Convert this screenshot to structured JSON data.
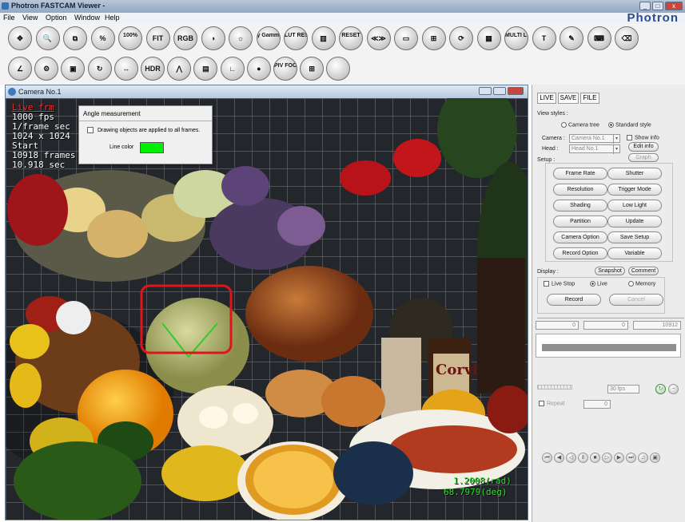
{
  "window": {
    "title": "Photron FASTCAM Viewer -",
    "brand": "Photron"
  },
  "menu": [
    "File",
    "View",
    "Option",
    "Window",
    "Help"
  ],
  "toolbar1": [
    {
      "icon": "move-icon",
      "label": "✥"
    },
    {
      "icon": "zoom-icon",
      "label": "🔍"
    },
    {
      "icon": "crop-icon",
      "label": "⧉"
    },
    {
      "icon": "percent-icon",
      "label": "%"
    },
    {
      "icon": "zoom100-icon",
      "label": "100%"
    },
    {
      "icon": "fit-icon",
      "label": "FIT"
    },
    {
      "icon": "rgb-icon",
      "label": "RGB"
    },
    {
      "icon": "contrast-icon",
      "label": "◑"
    },
    {
      "icon": "brightness-icon",
      "label": "☼"
    },
    {
      "icon": "gamma-icon",
      "label": "γ Gamma"
    },
    {
      "icon": "lut-reset-icon",
      "label": "LUT RESET"
    },
    {
      "icon": "color-bars-icon",
      "label": "▥"
    },
    {
      "icon": "color-reset-icon",
      "label": "RESET"
    },
    {
      "icon": "playback-icon",
      "label": "≪≫"
    },
    {
      "icon": "window-icon",
      "label": "▭"
    },
    {
      "icon": "split-icon",
      "label": "⊞"
    },
    {
      "icon": "refresh-icon",
      "label": "⟳"
    },
    {
      "icon": "multi-display-icon",
      "label": "▦"
    },
    {
      "icon": "multi-lock-icon",
      "label": "MULTI LOCK"
    },
    {
      "icon": "trigger-icon",
      "label": "T"
    },
    {
      "icon": "pen-icon",
      "label": "✎"
    },
    {
      "icon": "keyboard-icon",
      "label": "⌨"
    },
    {
      "icon": "eraser-icon",
      "label": "⌫"
    }
  ],
  "toolbar2": [
    {
      "icon": "angle-measure-icon",
      "label": "∠"
    },
    {
      "icon": "gear-icon",
      "label": "⚙"
    },
    {
      "icon": "chip-icon",
      "label": "▣"
    },
    {
      "icon": "rotate-icon",
      "label": "↻"
    },
    {
      "icon": "distance-icon",
      "label": "↔"
    },
    {
      "icon": "hdr-icon",
      "label": "HDR"
    },
    {
      "icon": "graph-icon",
      "label": "⋀"
    },
    {
      "icon": "frame-icon",
      "label": "▤"
    },
    {
      "icon": "angle-line-icon",
      "label": "∟"
    },
    {
      "icon": "dot-icon",
      "label": "●"
    },
    {
      "icon": "piv-focus-icon",
      "label": "PIV FOCUS"
    },
    {
      "icon": "grid-icon",
      "label": "⊞"
    },
    {
      "icon": "blank-icon",
      "label": ""
    }
  ],
  "camera": {
    "title": "Camera No.1",
    "overlay": [
      "Live frm",
      "1000 fps",
      "1/frame sec",
      "1024 x 1024",
      "Start",
      "10918 frames",
      "10.918 sec"
    ],
    "measure_rad": "1.2008(rad)",
    "measure_deg": "68.7979(deg)"
  },
  "angle_dialog": {
    "title": "Angle measurement",
    "checkbox_label": "Drawing objects are applied to all frames.",
    "line_color_label": "Line color",
    "line_color": "#00ee00"
  },
  "panel": {
    "tabs": [
      "LIVE",
      "SAVE",
      "FILE"
    ],
    "view_styles_label": "View styles :",
    "camera_tree": "Camera tree",
    "standard_style": "Standard style",
    "camera_label": "Camera :",
    "camera_value": "Camera No.1",
    "head_label": "Head :",
    "head_value": "Head No.1",
    "show_info": "Show info",
    "edit_info": "Edit info",
    "graph": "Graph",
    "setup_label": "Setup :",
    "setup_buttons": [
      "Frame Rate",
      "Shutter",
      "Resolution",
      "Trigger Mode",
      "Shading",
      "Low Light",
      "Partition",
      "Update",
      "Camera Option",
      "Save Setup",
      "Record Option",
      "Variable"
    ],
    "display_label": "Display :",
    "snapshot": "Snapshot",
    "comment": "Comment",
    "live_stop": "Live Stop",
    "live": "Live",
    "memory": "Memory",
    "record": "Record",
    "cancel": "Cancel",
    "spin_values": [
      "0",
      "0",
      "10912"
    ],
    "fps_value": "30 fps",
    "repeat_label": "Repeat",
    "repeat_value": "0"
  }
}
